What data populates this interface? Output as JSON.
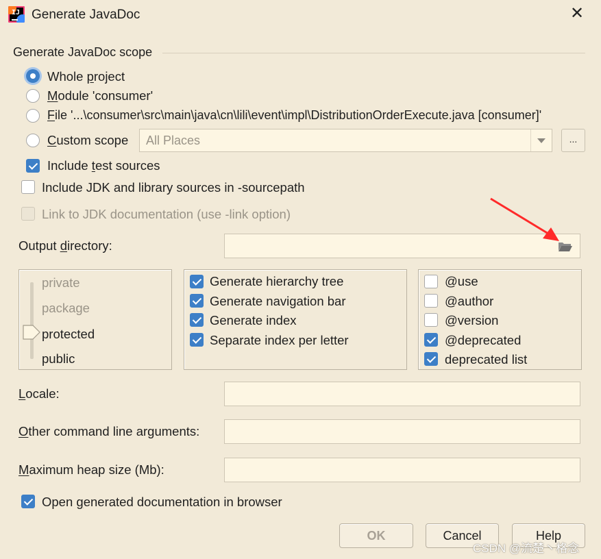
{
  "window": {
    "title": "Generate JavaDoc",
    "logo_text": "IJ",
    "close_glyph": "✕"
  },
  "scope": {
    "group_title": "Generate JavaDoc scope",
    "options": [
      {
        "pre": "Whole ",
        "u": "p",
        "post": "roject",
        "selected": true
      },
      {
        "pre": "",
        "u": "M",
        "post": "odule 'consumer'",
        "selected": false
      },
      {
        "pre": "",
        "u": "F",
        "post": "ile '...\\consumer\\src\\main\\java\\cn\\lili\\event\\impl\\DistributionOrderExecute.java [consumer]'",
        "selected": false
      },
      {
        "pre": "",
        "u": "C",
        "post": "ustom scope",
        "selected": false
      }
    ],
    "custom_scope_value": "All Places",
    "browse_label": "...",
    "include_test": {
      "pre": "Include ",
      "u": "t",
      "post": "est sources",
      "checked": true
    },
    "include_jdk": {
      "label": "Include JDK and library sources in -sourcepath",
      "checked": false
    },
    "link_jdk": {
      "label": "Link to JDK documentation (use -link option)",
      "checked": false,
      "disabled": true
    }
  },
  "output": {
    "pre": "Output ",
    "u": "d",
    "post": "irectory:",
    "value": "",
    "icon": "folder-open-icon"
  },
  "visibility": {
    "levels": [
      "private",
      "package",
      "protected",
      "public"
    ],
    "selected": "protected"
  },
  "generate_options": [
    {
      "label": "Generate hierarchy tree",
      "checked": true
    },
    {
      "label": "Generate navigation bar",
      "checked": true
    },
    {
      "label": "Generate index",
      "checked": true
    },
    {
      "label": "Separate index per letter",
      "checked": true
    }
  ],
  "tag_options": [
    {
      "label": "@use",
      "checked": false
    },
    {
      "label": "@author",
      "checked": false
    },
    {
      "label": "@version",
      "checked": false
    },
    {
      "label": "@deprecated",
      "checked": true
    },
    {
      "label": "deprecated list",
      "checked": true
    }
  ],
  "locale": {
    "u": "L",
    "post": "ocale:",
    "value": ""
  },
  "other_args": {
    "u": "O",
    "post": "ther command line arguments:",
    "value": ""
  },
  "heap": {
    "u": "M",
    "post": "aximum heap size (Mb):",
    "value": ""
  },
  "open_browser": {
    "pre": "Open ",
    "u": "g",
    "post": "enerated documentation in browser",
    "checked": true
  },
  "buttons": {
    "ok": "OK",
    "cancel": "Cancel",
    "help": "Help"
  },
  "watermark": "CSDN @流楚丶格念",
  "colors": {
    "accent": "#3d7fc7",
    "background": "#f2ead8",
    "field": "#fdf6e3",
    "annotation_arrow": "#ff2a2a"
  }
}
